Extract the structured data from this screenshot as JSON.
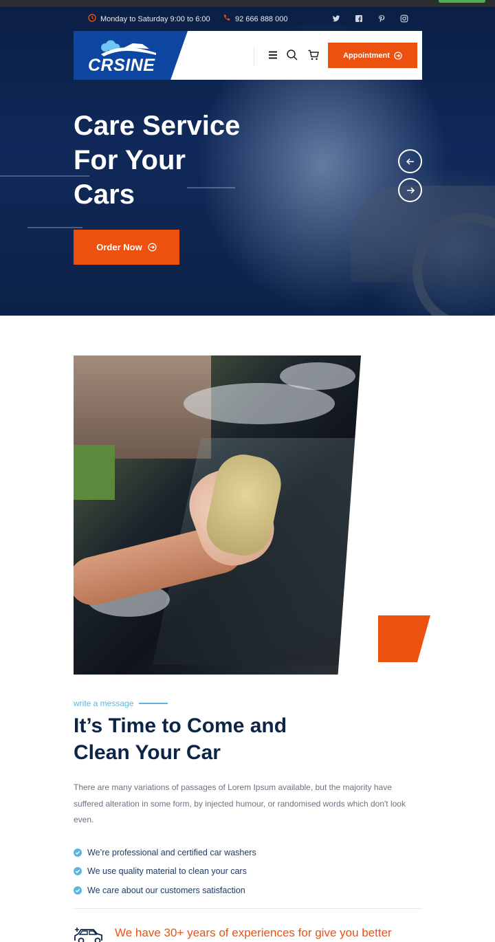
{
  "topbar": {
    "hours": "Monday to Saturday 9:00 to 6:00",
    "phone": "92 666 888 000",
    "social_icons": [
      "twitter-icon",
      "facebook-icon",
      "pinterest-icon",
      "instagram-icon"
    ]
  },
  "nav": {
    "logo_text": "CRSINE",
    "appointment_label": "Appointment",
    "icons": [
      "menu-icon",
      "search-icon",
      "cart-icon"
    ]
  },
  "hero": {
    "title_lines": [
      "Care Service",
      "For Your",
      "Cars"
    ],
    "order_label": "Order Now"
  },
  "about": {
    "tagline": "write a message",
    "title_lines": [
      "It’s Time to Come and",
      "Clean Your Car"
    ],
    "description": "There are many variations of passages of Lorem Ipsum available, but the majority have suffered alteration in some form, by injected humour, or randomised words which don't look even.",
    "features": [
      "We’re professional and certified car washers",
      "We use quality material to clean your cars",
      "We care about our customers satisfaction"
    ],
    "experience_text": "We have 30+ years of experiences for give you better"
  },
  "colors": {
    "accent": "#ec5110",
    "brand_blue": "#0d47a1",
    "heading": "#0b2447",
    "tagline": "#5ab6df"
  }
}
